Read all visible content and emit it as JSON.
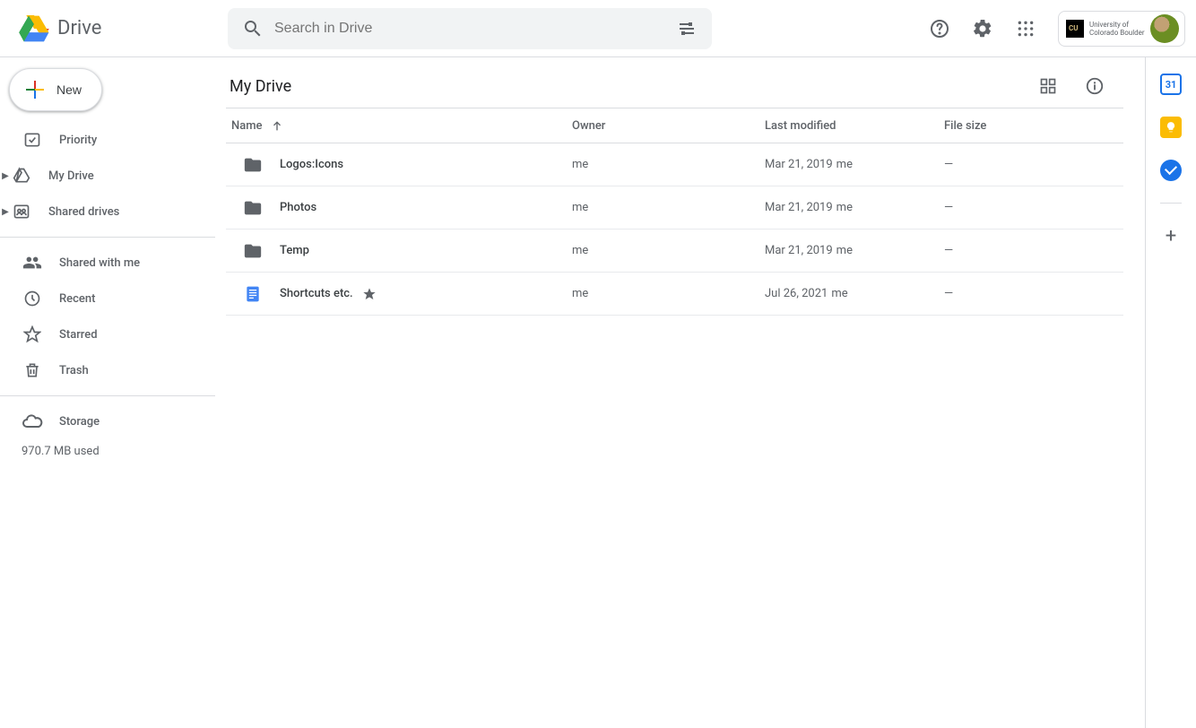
{
  "header": {
    "app_name": "Drive",
    "search_placeholder": "Search in Drive",
    "org_label": "University of Colorado Boulder"
  },
  "sidebar": {
    "new_label": "New",
    "items": [
      {
        "label": "Priority",
        "icon": "priority"
      },
      {
        "label": "My Drive",
        "icon": "mydrive",
        "expandable": true
      },
      {
        "label": "Shared drives",
        "icon": "shareddrives",
        "expandable": true
      }
    ],
    "items2": [
      {
        "label": "Shared with me",
        "icon": "sharedwithme"
      },
      {
        "label": "Recent",
        "icon": "recent"
      },
      {
        "label": "Starred",
        "icon": "starred"
      },
      {
        "label": "Trash",
        "icon": "trash"
      }
    ],
    "storage_label": "Storage",
    "storage_used": "970.7 MB used"
  },
  "content": {
    "breadcrumb": "My Drive",
    "columns": {
      "name": "Name",
      "owner": "Owner",
      "modified": "Last modified",
      "size": "File size"
    },
    "rows": [
      {
        "type": "folder",
        "name": "Logos:Icons",
        "owner": "me",
        "modified": "Mar 21, 2019",
        "modified_by": "me",
        "size": "—",
        "starred": false
      },
      {
        "type": "folder",
        "name": "Photos",
        "owner": "me",
        "modified": "Mar 21, 2019",
        "modified_by": "me",
        "size": "—",
        "starred": false
      },
      {
        "type": "folder",
        "name": "Temp",
        "owner": "me",
        "modified": "Mar 21, 2019",
        "modified_by": "me",
        "size": "—",
        "starred": false
      },
      {
        "type": "doc",
        "name": "Shortcuts etc.",
        "owner": "me",
        "modified": "Jul 26, 2021",
        "modified_by": "me",
        "size": "—",
        "starred": true
      }
    ]
  },
  "side_panel": {
    "calendar_day": "31"
  }
}
